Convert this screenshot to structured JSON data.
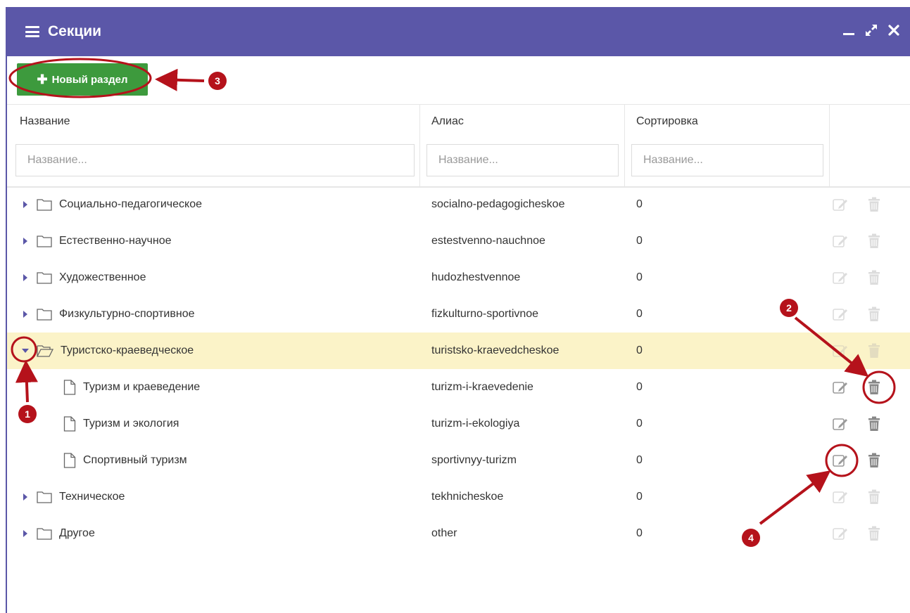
{
  "window": {
    "title": "Секции"
  },
  "toolbar": {
    "new_section_label": "Новый раздел"
  },
  "columns": {
    "name": "Название",
    "alias": "Алиас",
    "sort": "Сортировка"
  },
  "filters": {
    "name_placeholder": "Название...",
    "alias_placeholder": "Название...",
    "sort_placeholder": "Название..."
  },
  "rows": [
    {
      "name": "Социально-педагогическое",
      "alias": "socialno-pedagogicheskoe",
      "sort": "0"
    },
    {
      "name": "Естественно-научное",
      "alias": "estestvenno-nauchnoe",
      "sort": "0"
    },
    {
      "name": "Художественное",
      "alias": "hudozhestvennoe",
      "sort": "0"
    },
    {
      "name": "Физкультурно-спортивное",
      "alias": "fizkulturno-sportivnoe",
      "sort": "0"
    },
    {
      "name": "Туристско-краеведческое",
      "alias": "turistsko-kraevedcheskoe",
      "sort": "0"
    },
    {
      "name": "Туризм и краеведение",
      "alias": "turizm-i-kraevedenie",
      "sort": "0"
    },
    {
      "name": "Туризм и экология",
      "alias": "turizm-i-ekologiya",
      "sort": "0"
    },
    {
      "name": "Спортивный туризм",
      "alias": "sportivnyy-turizm",
      "sort": "0"
    },
    {
      "name": "Техническое",
      "alias": "tekhnicheskoe",
      "sort": "0"
    },
    {
      "name": "Другое",
      "alias": "other",
      "sort": "0"
    }
  ],
  "callouts": [
    "1",
    "2",
    "3",
    "4"
  ],
  "colors": {
    "titlebar": "#5b57a8",
    "new_button": "#3d9a3d",
    "active_row": "#fbf3c8",
    "callout": "#b5121b"
  }
}
